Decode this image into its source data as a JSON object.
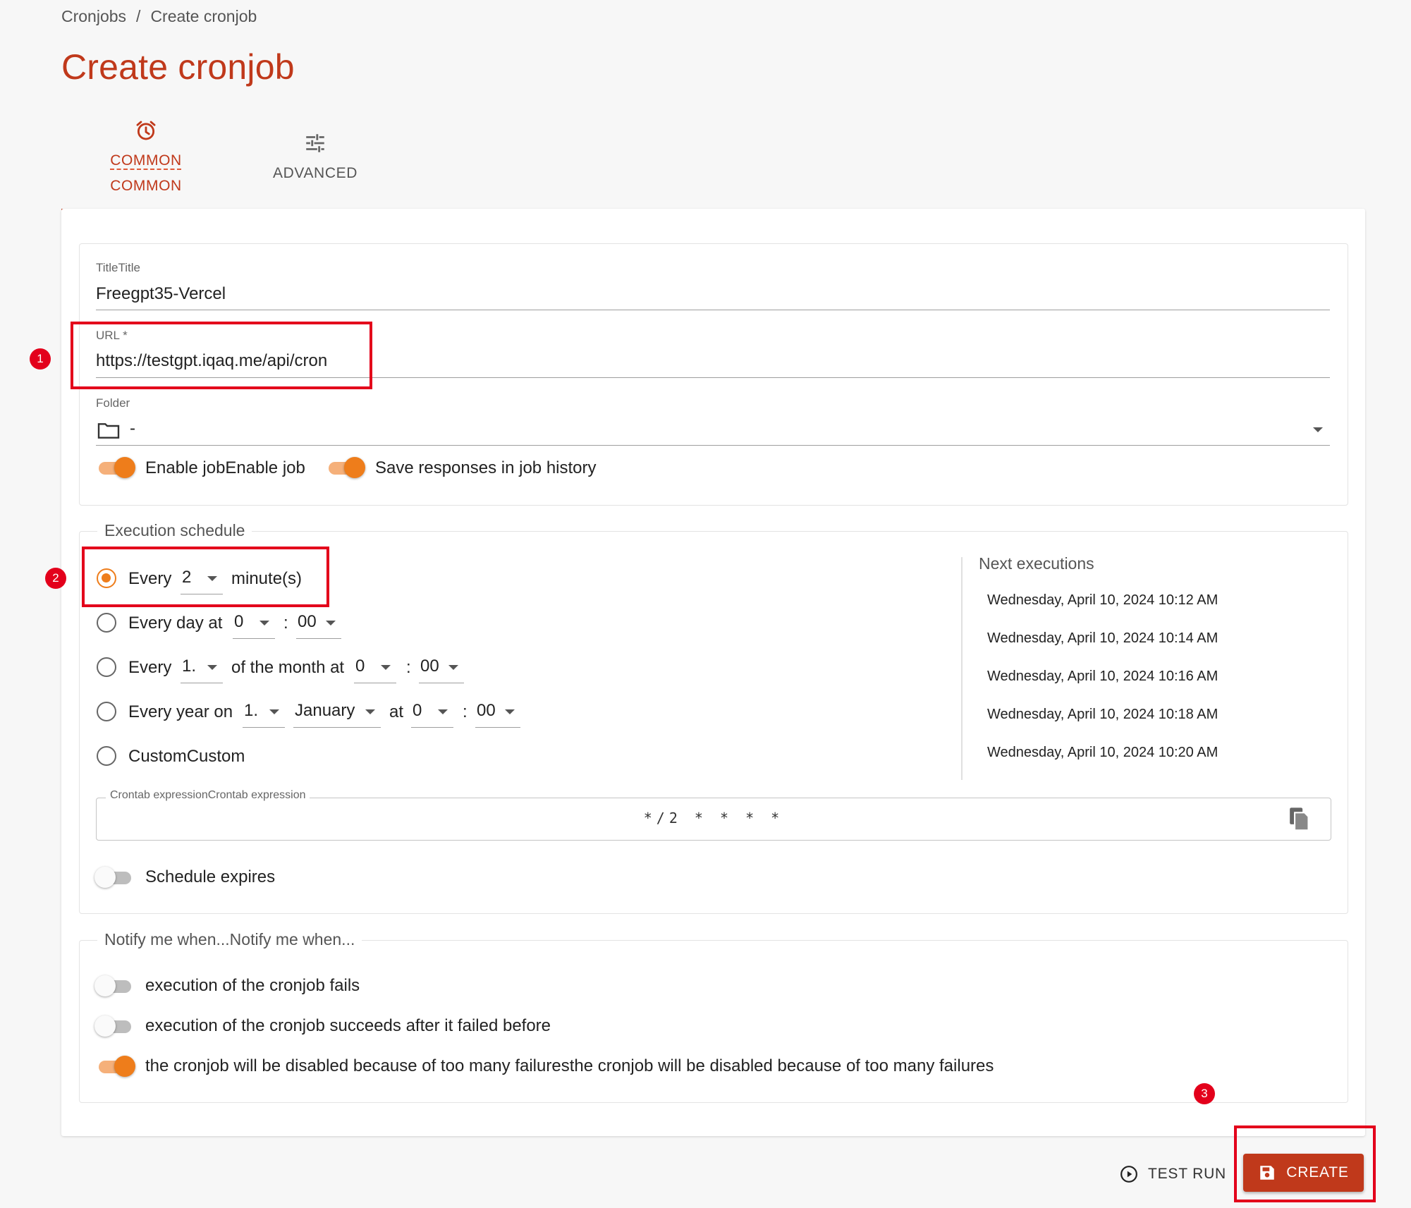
{
  "breadcrumb": {
    "parent": "Cronjobs",
    "separator": "/",
    "current": "Create cronjob"
  },
  "page_title": "Create cronjob",
  "tabs": {
    "common": {
      "label": "COMMON",
      "label_dup": "COMMON",
      "icon": "alarm-clock-icon"
    },
    "advanced": {
      "label": "ADVANCED",
      "icon": "sliders-icon"
    }
  },
  "form": {
    "title_label": "TitleTitle",
    "title_value": "Freegpt35-Vercel",
    "url_label": "URL *",
    "url_value": "https://testgpt.iqaq.me/api/cron",
    "folder_label": "Folder",
    "folder_value": "-",
    "enable_job_label": "Enable jobEnable job",
    "enable_job_on": true,
    "save_responses_label": "Save responses in job history",
    "save_responses_on": true
  },
  "schedule": {
    "legend": "Execution schedule",
    "opt_every": {
      "prefix": "Every",
      "value": "2",
      "suffix": "minute(s)"
    },
    "opt_day": {
      "prefix": "Every day at",
      "hour": "0",
      "sep": ":",
      "minute": "00"
    },
    "opt_month": {
      "prefix": "Every",
      "day": "1.",
      "middle": "of the month at",
      "hour": "0",
      "sep": ":",
      "minute": "00"
    },
    "opt_year": {
      "prefix": "Every year on",
      "day": "1.",
      "month": "January",
      "at": "at",
      "hour": "0",
      "sep": ":",
      "minute": "00"
    },
    "opt_custom": {
      "label": "CustomCustom"
    },
    "selected": "every_minutes",
    "crontab_label": "Crontab expressionCrontab expression",
    "crontab_value": "*/2 * * * *",
    "expires_label": "Schedule expires",
    "expires_on": false
  },
  "next_executions": {
    "title": "Next executions",
    "items": [
      "Wednesday, April 10, 2024 10:12 AM",
      "Wednesday, April 10, 2024 10:14 AM",
      "Wednesday, April 10, 2024 10:16 AM",
      "Wednesday, April 10, 2024 10:18 AM",
      "Wednesday, April 10, 2024 10:20 AM"
    ]
  },
  "notify": {
    "legend": "Notify me when...Notify me when...",
    "fails": {
      "label": "execution of the cronjob fails",
      "on": false
    },
    "succeeds": {
      "label": "execution of the cronjob succeeds after it failed before",
      "on": false
    },
    "disabled": {
      "label": "the cronjob will be disabled because of too many failuresthe cronjob will be disabled because of too many failures",
      "on": true
    }
  },
  "actions": {
    "test_run": "TEST RUN",
    "create": "CREATE"
  },
  "annotations": {
    "one": "1",
    "two": "2",
    "three": "3"
  },
  "colors": {
    "accent": "#c0391b",
    "toggle_on": "#ee7d1b",
    "annotation": "#e3001b"
  }
}
